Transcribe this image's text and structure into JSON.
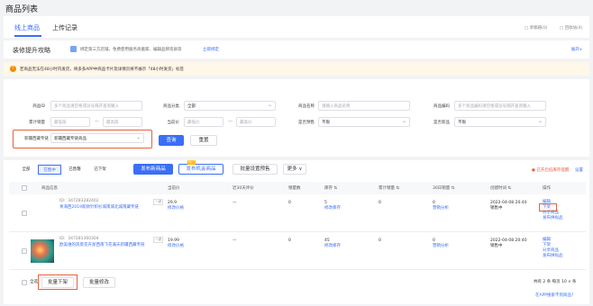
{
  "page_title": "商品列表",
  "tabs": {
    "online": "线上商品",
    "uploads": "上传记录"
  },
  "tab_right": {
    "drafts": "□ 草稿箱(0)",
    "deleted": "□ 回收站(4)"
  },
  "tips": {
    "title": "装修提升攻略",
    "text": "绑定第三方店铺，免费使用服务商搬家、编辑品牌资质等",
    "link": "立即绑定",
    "expand": "展开∨"
  },
  "notice": "若商品无法在48小时内发货，将多多APP中商品卡片及详情页将不展示「48小时发货」标签",
  "filters": {
    "row1": [
      {
        "label": "商品ID",
        "placeholder": "多个商品请空格或逗号隔开查询输入"
      },
      {
        "label": "商品分类",
        "value": "全部"
      },
      {
        "label": "商品名称",
        "placeholder": "请输入商品名称"
      },
      {
        "label": "商品编码",
        "placeholder": "多个商品编码请空格或逗号隔开查询输入"
      }
    ],
    "row2": {
      "sales_label": "累计销量",
      "sales_min": "最低值",
      "sales_max": "最高值",
      "price_label": "当前价",
      "price_min": "最低价",
      "price_max": "最高价",
      "presale_label": "是否预售",
      "presale_value": "不限",
      "new_label": "是否新品",
      "new_value": "不限"
    },
    "row3": {
      "label": "新疆西藏专链",
      "value": "新疆西藏专链商品"
    },
    "query": "查询",
    "reset": "重置"
  },
  "list": {
    "segments": [
      "全部",
      "在售中",
      "已售罄",
      "已下架"
    ],
    "publish": "发布新商品",
    "publish_opportunity": "发布机会商品",
    "badge": "热门",
    "batch_presale": "批量设置预售",
    "more": "更多 ∨",
    "stock_alert": "● 已开启低库存提醒",
    "settings": "设置",
    "headers": [
      "商品信息",
      "当前价",
      "近30天评价",
      "销量数",
      "库存 ⇅",
      "累计销量 ⇅",
      "30日销量 ⇅",
      "创建时间 ⇅",
      "操作"
    ],
    "rows": [
      {
        "id": "ID：347283282402",
        "name": "青海西2019新款针织衫城南城北城南藏专链",
        "copy": "一键",
        "price": "29.9",
        "price_action": "修改价格",
        "eval": "—",
        "sales": "0",
        "stock": "5",
        "stock_action": "修改库存",
        "total": "0",
        "m30": "0",
        "m30_action": "营销分析",
        "created": "2022-04-08 20:40",
        "status": "销售中",
        "ops": [
          "编辑",
          "下架",
          "分享商品",
          "发布拼拟品"
        ]
      },
      {
        "id": "ID：347281360304",
        "name": "欧美维的风景花卉浙西南飞花满天新疆西藏专链",
        "copy": "一键",
        "price": "19.99",
        "price_action": "修改价格",
        "eval": "—",
        "sales": "0",
        "stock": "45",
        "stock_action": "修改库存",
        "total": "0",
        "m30": "0",
        "m30_action": "营销分析",
        "created": "2022-04-08 20:40",
        "status": "销售中",
        "ops": [
          "编辑",
          "下架",
          "分享商品",
          "发布拼拟品"
        ]
      }
    ],
    "footer": {
      "select_all": "全选",
      "batch_delist": "批量下架",
      "batch_edit": "批量修改",
      "pagination": "共有 2 条  每页 10 ∨ 条",
      "app_link": "在APP搜索不到商品？"
    }
  },
  "colors": {
    "accent": "#3a6ef6",
    "highlight": "#e8603c",
    "warning": "#f08c00"
  }
}
